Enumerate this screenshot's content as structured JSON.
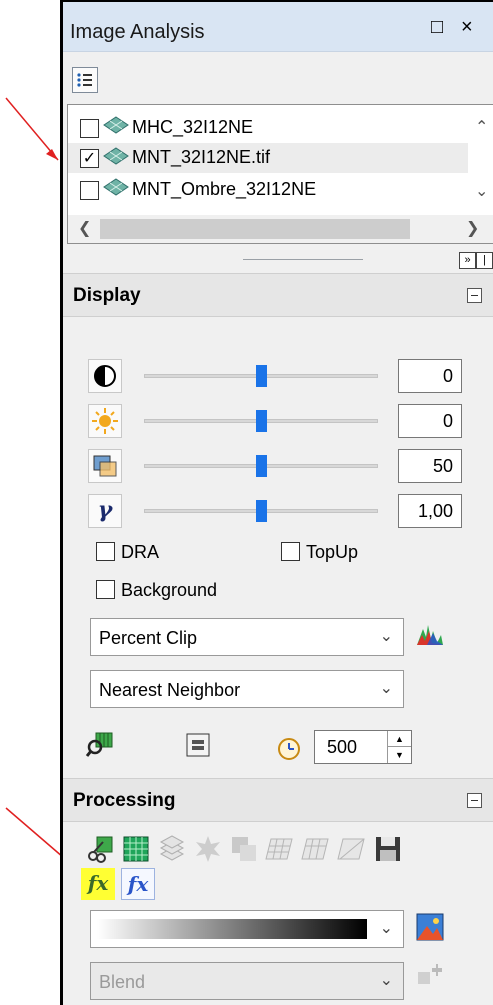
{
  "panel": {
    "title": "Image Analysis",
    "maximize_glyph": "□",
    "close_glyph": "×",
    "options_icon": "list-options-icon"
  },
  "layers": [
    {
      "name": "MHC_32I12NE",
      "checked": false
    },
    {
      "name": "MNT_32I12NE.tif",
      "checked": true
    },
    {
      "name": "MNT_Ombre_32I12NE",
      "checked": false
    }
  ],
  "display": {
    "title": "Display",
    "sliders": [
      {
        "name": "contrast",
        "icon": "contrast-icon",
        "value": "0",
        "level": 0.5
      },
      {
        "name": "brightness",
        "icon": "brightness-icon",
        "value": "0",
        "level": 0.5
      },
      {
        "name": "transparency",
        "icon": "transparency-icon",
        "value": "50",
        "level": 0.5
      },
      {
        "name": "gamma",
        "icon": "gamma-icon",
        "value": "1,00",
        "level": 0.5
      }
    ],
    "dra_label": "DRA",
    "topup_label": "TopUp",
    "background_label": "Background",
    "stretch_type": "Percent Clip",
    "resampling": "Nearest Neighbor",
    "refresh_interval": "500"
  },
  "processing": {
    "title": "Processing",
    "color_ramp_label": "",
    "blend_label": "Blend",
    "function_icons": [
      "fx-yellow-icon",
      "fx-blue-icon"
    ]
  },
  "colors": {
    "accent": "#1a73e8",
    "annotation_arrow": "#e02020",
    "highlight": "#ffff33"
  }
}
